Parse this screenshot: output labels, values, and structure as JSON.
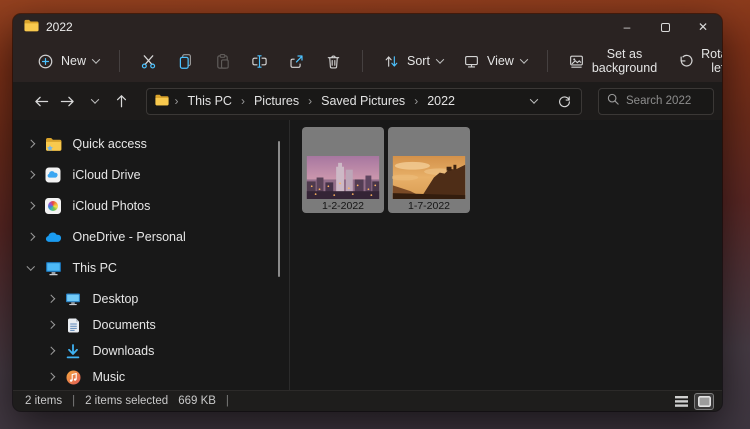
{
  "window": {
    "title": "2022"
  },
  "titlebar": {
    "minimize": "–",
    "close": "✕"
  },
  "toolbar": {
    "new": "New",
    "sort": "Sort",
    "view": "View",
    "set_background": "Set as background",
    "rotate_left": "Rotate left",
    "more": "•••"
  },
  "addressbar": {
    "crumbs": [
      "This PC",
      "Pictures",
      "Saved Pictures",
      "2022"
    ],
    "separator": "›",
    "search_placeholder": "Search 2022"
  },
  "sidebar": {
    "items": [
      {
        "label": "Quick access"
      },
      {
        "label": "iCloud Drive"
      },
      {
        "label": "iCloud Photos"
      },
      {
        "label": "OneDrive - Personal"
      },
      {
        "label": "This PC"
      },
      {
        "label": "Desktop"
      },
      {
        "label": "Documents"
      },
      {
        "label": "Downloads"
      },
      {
        "label": "Music"
      }
    ]
  },
  "content": {
    "files": [
      {
        "name": "1-2-2022"
      },
      {
        "name": "1-7-2022"
      }
    ]
  },
  "statusbar": {
    "count": "2 items",
    "sep": "|",
    "selected": "2 items selected",
    "size": "669 KB"
  },
  "colors": {
    "accent": "#4cc2ff",
    "folder_yellow": "#f6c445",
    "onedrive_blue": "#1a9bf0",
    "selection_tile": "#7b7b7b"
  }
}
